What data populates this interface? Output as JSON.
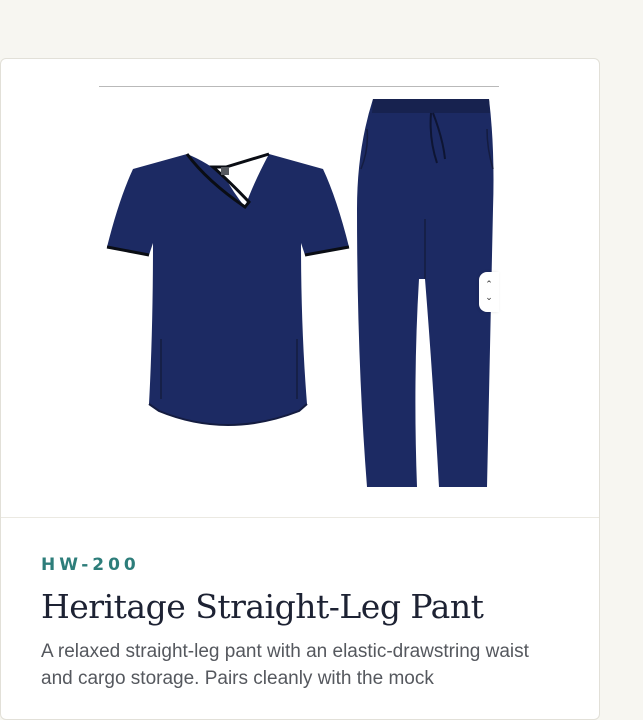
{
  "product": {
    "sku": "HW-200",
    "title": "Heritage Straight-Leg Pant",
    "description": "A relaxed straight-leg pant with an elastic-drawstring waist and cargo storage. Pairs cleanly with the mock"
  },
  "gallery": {
    "image_alt": "Navy scrub top and straight-leg pant",
    "scroll_up_glyph": "⌃",
    "scroll_down_glyph": "⌄"
  },
  "colors": {
    "navy": "#1c2a63",
    "accent": "#2d7d7a"
  }
}
